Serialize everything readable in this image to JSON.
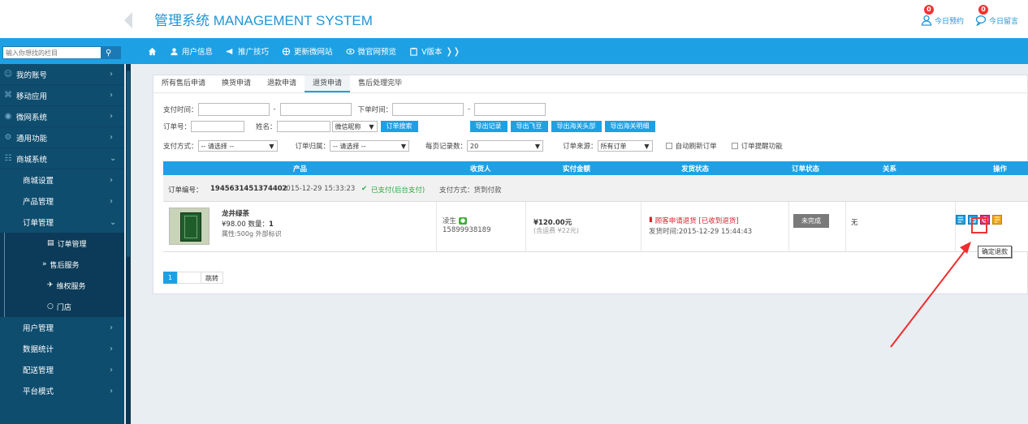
{
  "app": {
    "title": "管理系统 MANAGEMENT SYSTEM"
  },
  "top_right": [
    {
      "label": "今日预约",
      "count": "0",
      "icon": "user-icon"
    },
    {
      "label": "今日留言",
      "count": "0",
      "icon": "chat-icon"
    }
  ],
  "search": {
    "placeholder": "输入你想找的栏目"
  },
  "navbar": {
    "items": [
      {
        "label": "用户信息",
        "icon": "user-icon"
      },
      {
        "label": "推广技巧",
        "icon": "megaphone-icon"
      },
      {
        "label": "更新微网站",
        "icon": "globe-icon"
      },
      {
        "label": "微官网预览",
        "icon": "eye-icon"
      },
      {
        "label": "V版本",
        "icon": "clipboard-icon"
      }
    ]
  },
  "sidebar": {
    "items": [
      {
        "label": "我的账号",
        "icon": "person-icon"
      },
      {
        "label": "移动应用",
        "icon": "apps-icon"
      },
      {
        "label": "微网系统",
        "icon": "globe-icon"
      },
      {
        "label": "通用功能",
        "icon": "settings-icon"
      },
      {
        "label": "商城系统",
        "icon": "cart-icon"
      }
    ],
    "subitems": [
      {
        "label": "商城设置"
      },
      {
        "label": "产品管理"
      },
      {
        "label": "订单管理"
      }
    ],
    "order_sub": [
      {
        "label": "订单管理"
      },
      {
        "label": "售后服务"
      },
      {
        "label": "维权服务"
      },
      {
        "label": "门店"
      }
    ],
    "bottom_items": [
      {
        "label": "用户管理"
      },
      {
        "label": "数据统计"
      },
      {
        "label": "配送管理"
      },
      {
        "label": "平台模式"
      }
    ]
  },
  "tabs": [
    "所有售后申请",
    "换货申请",
    "退款申请",
    "退货申请",
    "售后处理完毕"
  ],
  "filters": {
    "pay_time_label": "支付时间：",
    "order_time_label": "下单时间：",
    "dash": "-",
    "order_no_label": "订单号：",
    "name_label": "姓名：",
    "nickname_select": "微信昵称",
    "search_btn": "订单搜索",
    "export_buttons": [
      "导出记录",
      "导出飞豆",
      "导出海关头部",
      "导出海关明细"
    ],
    "pay_method_label": "支付方式：",
    "pay_method_value": "-- 请选择 --",
    "order_owner_label": "订单归属：",
    "order_owner_value": "-- 请选择 --",
    "per_page_label": "每页记录数：",
    "per_page_value": "20",
    "source_label": "订单来源：",
    "source_value": "所有订单",
    "auto_refresh": "自动刷新订单",
    "order_remind": "订单提醒功能"
  },
  "table": {
    "headers": [
      "产品",
      "收货人",
      "实付金额",
      "发货状态",
      "订单状态",
      "关系",
      "操作"
    ]
  },
  "order": {
    "no_label": "订单编号：",
    "no": "1945631451374402",
    "time": "2015-12-29 15:33:23",
    "pay_status": "已支付(后台支付)",
    "pay_method": "支付方式：货到付款",
    "product_name": "龙井绿茶",
    "price_qty_prefix": "¥98.00 数量：",
    "qty": "1",
    "attr": "属性:500g 外部标识",
    "receiver": "凌生",
    "phone": "15899938189",
    "amount": "¥120.00元",
    "shipping_fee": "(含运费 ¥22元)",
    "ship_status": "顾客申请退货 [已收到退货]",
    "ship_time": "发货时间:2015-12-29 15:44:43",
    "order_status": "未完成",
    "relation": "无"
  },
  "pager": {
    "current": "1",
    "jump": "跳转"
  },
  "tooltip": "确定退款",
  "colors": {
    "accent": "#1ea1e4",
    "sidebar": "#0f4d6f",
    "alert": "#e33333"
  }
}
